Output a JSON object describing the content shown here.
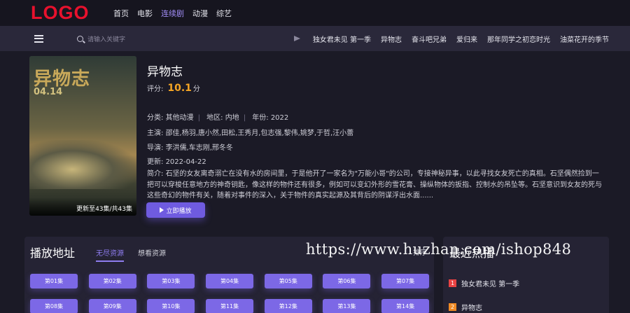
{
  "header": {
    "logo": "LOGO",
    "nav": [
      {
        "label": "首页",
        "active": false
      },
      {
        "label": "电影",
        "active": false
      },
      {
        "label": "连续剧",
        "active": true
      },
      {
        "label": "动漫",
        "active": false
      },
      {
        "label": "综艺",
        "active": false
      }
    ]
  },
  "subbar": {
    "search_placeholder": "请输入关键字",
    "hot_links": [
      "独女君未见 第一季",
      "异物志",
      "奋斗吧兄弟",
      "爱归来",
      "那年同学之初恋时光",
      "油菜花开的季节"
    ]
  },
  "detail": {
    "poster_title": "异物志",
    "poster_date": "04.14",
    "poster_badge": "更新至43集/共43集",
    "title": "异物志",
    "rating_label": "评分:",
    "rating_value": "10.1",
    "rating_unit": "分",
    "category_label": "分类:",
    "category": "其他动漫",
    "region_label": "地区:",
    "region": "内地",
    "year_label": "年份:",
    "year": "2022",
    "cast_label": "主演:",
    "cast": "邵佳,杨羽,唐小然,田松,王秀月,包志强,黎伟,姚梦,于哲,汪小蕾",
    "director_label": "导演:",
    "director": "李洪儒,车志刚,邢冬冬",
    "updated_label": "更新:",
    "updated": "2022-04-22",
    "desc_label": "简介:",
    "desc": "石坚的女友离奇溺亡在没有水的房间里，于是他开了一家名为\"万能小哥\"的公司，专接神秘异事，以此寻找女友死亡的真相。石坚偶然捡到一把可以穿梭任意地方的神奇钥匙，像这样的物件还有很多，例如可以变幻外形的雪花膏、操纵物体的扳指、控制水的吊坠等。石坚意识到女友的死与这些奇幻的物件有关，随着对事件的深入，关于物件的真实起源及其背后的阴谋浮出水面......",
    "play_button": "立即播放"
  },
  "playlist": {
    "title": "播放地址",
    "sources": [
      {
        "label": "无尽资源",
        "active": true
      },
      {
        "label": "想看资源",
        "active": false
      }
    ],
    "sort_label": "排序",
    "episodes": [
      "第01集",
      "第02集",
      "第03集",
      "第04集",
      "第05集",
      "第06集",
      "第07集",
      "第08集",
      "第09集",
      "第10集",
      "第11集",
      "第12集",
      "第13集",
      "第14集"
    ]
  },
  "hot": {
    "title": "最近热播",
    "items": [
      {
        "rank": "1",
        "title": "独女君未见 第一季",
        "color": "#e84343"
      },
      {
        "rank": "2",
        "title": "异物志",
        "color": "#f08a24"
      }
    ]
  },
  "watermark": "https://www.huzhan.com/ishop848",
  "colors": {
    "accent": "#7c68e6",
    "logo": "#e8112d",
    "rating": "#f5a524"
  }
}
